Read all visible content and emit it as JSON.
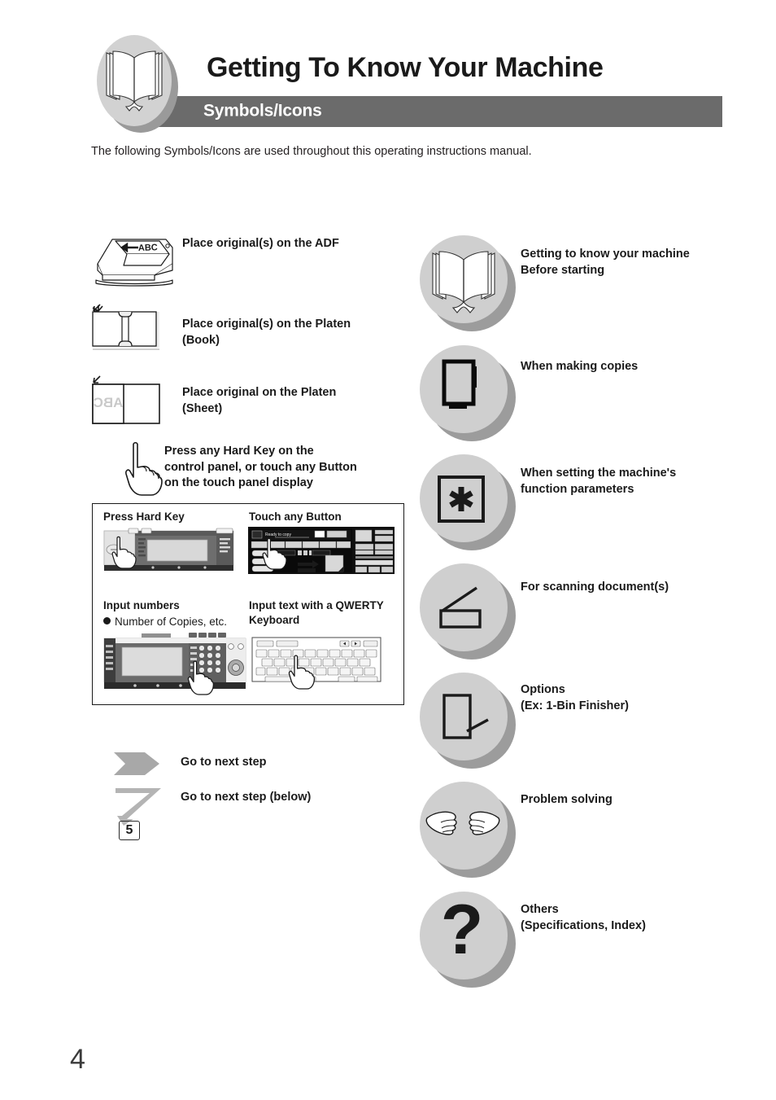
{
  "header": {
    "title": "Getting To Know Your Machine",
    "banner_label": "Symbols/Icons",
    "badge_icon": "open-book-icon",
    "banner_color": "#6b6b6b",
    "badge_color": "#d2d2d2"
  },
  "intro": {
    "text": "The following Symbols/Icons are used throughout this operating instructions manual."
  },
  "left_column": {
    "items": [
      {
        "icon": "adf-feeder-icon",
        "label": "Place original(s) on the ADF"
      },
      {
        "icon": "platen-book-icon",
        "label": "Place original(s) on the Platen\n(Book)"
      },
      {
        "icon": "platen-sheet-icon",
        "label": "Place original on the Platen\n(Sheet)"
      },
      {
        "icon": "pointing-hand-icon",
        "label": "Press any Hard Key on the\ncontrol panel, or touch any Button\non the touch panel display"
      }
    ]
  },
  "demo_box": {
    "cells": [
      {
        "caption": "Press Hard Key",
        "subtext": "",
        "illustration": "control-panel-hardkey-illustration"
      },
      {
        "caption": "Touch any Button",
        "subtext": "",
        "illustration": "touch-panel-display-illustration"
      },
      {
        "caption": "Input numbers",
        "subtext": "Number of Copies, etc.",
        "illustration": "control-panel-keypad-illustration"
      },
      {
        "caption": "Input text with a QWERTY\nKeyboard",
        "subtext": "",
        "illustration": "qwerty-keyboard-illustration"
      }
    ]
  },
  "flow_arrows": {
    "items": [
      {
        "icon": "chevron-arrow-right-icon",
        "label": "Go to next step"
      },
      {
        "icon": "bent-arrow-down-icon",
        "label": "Go to next step (below)"
      }
    ],
    "step_number": "5"
  },
  "right_column": {
    "items": [
      {
        "icon": "open-book-icon",
        "label": "Getting to know your machine\nBefore starting"
      },
      {
        "icon": "copy-page-icon",
        "label": "When making copies"
      },
      {
        "icon": "asterisk-key-icon",
        "label": "When setting the machine's\nfunction parameters"
      },
      {
        "icon": "scanner-icon",
        "label": "For scanning document(s)"
      },
      {
        "icon": "finisher-option-icon",
        "label": "Options\n(Ex: 1-Bin Finisher)"
      },
      {
        "icon": "helping-hands-icon",
        "label": "Problem solving"
      },
      {
        "icon": "question-mark-icon",
        "label": "Others\n(Specifications, Index)"
      }
    ],
    "circle_color": "#cfcfcf",
    "shadow_color": "#9c9c9c"
  },
  "page_number": "4"
}
